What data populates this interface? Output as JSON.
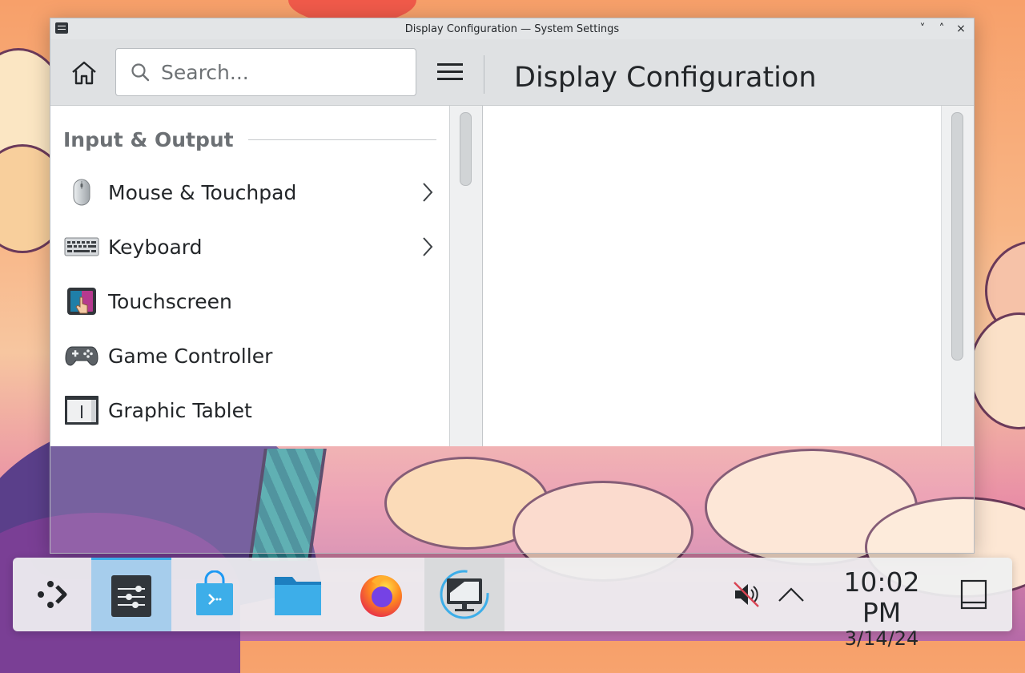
{
  "window": {
    "title": "Display Configuration — System Settings",
    "controls": {
      "minimize": "˅",
      "maximize": "˄",
      "close": "×"
    }
  },
  "toolbar": {
    "search_placeholder": "Search...",
    "page_title": "Display Configuration"
  },
  "sidebar": {
    "section": "Input & Output",
    "items": [
      {
        "label": "Mouse & Touchpad",
        "icon": "mouse-icon",
        "has_children": true
      },
      {
        "label": "Keyboard",
        "icon": "keyboard-icon",
        "has_children": true
      },
      {
        "label": "Touchscreen",
        "icon": "touchscreen-icon",
        "has_children": false
      },
      {
        "label": "Game Controller",
        "icon": "gamepad-icon",
        "has_children": false
      },
      {
        "label": "Graphic Tablet",
        "icon": "tablet-icon",
        "has_children": false
      }
    ]
  },
  "taskbar": {
    "apps": [
      {
        "name": "app-launcher",
        "icon": "launcher-icon"
      },
      {
        "name": "system-settings",
        "icon": "settings-sliders-icon",
        "state": "active"
      },
      {
        "name": "discover",
        "icon": "store-bag-icon"
      },
      {
        "name": "dolphin",
        "icon": "folder-icon"
      },
      {
        "name": "firefox",
        "icon": "firefox-icon"
      },
      {
        "name": "display-configuration",
        "icon": "display-icon",
        "state": "open"
      }
    ],
    "tray": {
      "volume_icon": "volume-muted-icon",
      "expand_icon": "chevron-up-icon",
      "show_desktop_icon": "peek-desktop-icon"
    },
    "clock": {
      "time": "10:02 PM",
      "date": "3/14/24"
    }
  },
  "colors": {
    "accent": "#3daee9",
    "text": "#232629",
    "section_header": "#6c7074"
  }
}
